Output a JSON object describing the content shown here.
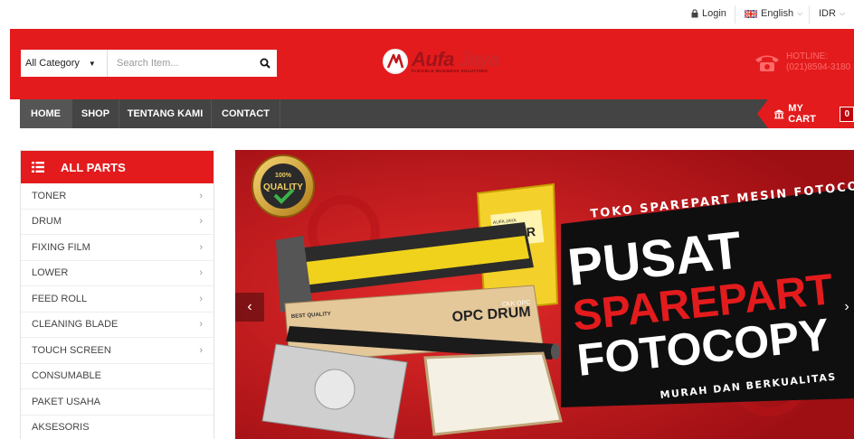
{
  "topbar": {
    "login": "Login",
    "language": "English",
    "currency": "IDR"
  },
  "header": {
    "search": {
      "category": "All Category",
      "placeholder": "Search Item...",
      "value": ""
    },
    "logo": {
      "brand_bold": "Aufa",
      "brand_light": "Jaya",
      "tagline": "FLEXIBLE BUSINESS SOLUTIONS"
    },
    "hotline": {
      "label": "HOTLINE:",
      "number": "(021)8594-3180"
    }
  },
  "nav": {
    "items": [
      {
        "label": "Home",
        "active": true
      },
      {
        "label": "Shop"
      },
      {
        "label": "Tentang Kami"
      },
      {
        "label": "Contact"
      }
    ],
    "cart": {
      "label": "MY CART",
      "count": "0"
    }
  },
  "sidebar": {
    "title": "ALL PARTS",
    "items": [
      {
        "label": "TONER",
        "has_children": true
      },
      {
        "label": "DRUM",
        "has_children": true
      },
      {
        "label": "FIXING FILM",
        "has_children": true
      },
      {
        "label": "LOWER",
        "has_children": true
      },
      {
        "label": "FEED ROLL",
        "has_children": true
      },
      {
        "label": "CLEANING BLADE",
        "has_children": true
      },
      {
        "label": "TOUCH SCREEN",
        "has_children": true
      },
      {
        "label": "CONSUMABLE",
        "has_children": false
      },
      {
        "label": "PAKET USAHA",
        "has_children": false
      },
      {
        "label": "AKSESORIS",
        "has_children": false
      }
    ]
  },
  "banner": {
    "top_text": "TOKO SPAREPART MESIN FOTOCOPY",
    "headline_1": "PUSAT",
    "headline_2": "SPAREPART",
    "headline_3": "FOTOCOPY",
    "bottom_text": "MURAH DAN BERKUALITAS",
    "badge_top": "100%",
    "badge_main": "QUALITY",
    "toner_brand": "AUFA JAYA",
    "toner_label": "TONER",
    "drum_label": "OPC DRUM",
    "drum_brand": "CKK OPC",
    "box_label": "BEST QUALITY",
    "prev": "‹",
    "next": "›"
  },
  "colors": {
    "brand_red": "#e31b1d",
    "nav_dark": "#444444"
  }
}
